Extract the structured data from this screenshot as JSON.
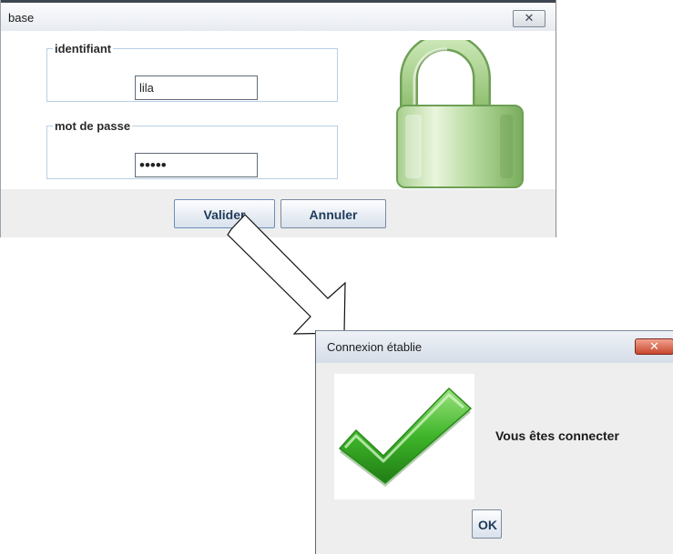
{
  "login_window": {
    "title": "base",
    "close_icon": "close-icon",
    "identifiant": {
      "legend": "identifiant",
      "value": "lila"
    },
    "password": {
      "legend": "mot de passe",
      "masked_value": "•••••"
    },
    "image": "open-padlock-icon",
    "buttons": {
      "valider": "Valider",
      "annuler": "Annuler"
    }
  },
  "arrow": {
    "icon": "down-right-arrow"
  },
  "confirm_dialog": {
    "title": "Connexion établie",
    "close_icon": "close-icon",
    "image": "green-checkmark-icon",
    "message": "Vous êtes connecter",
    "ok_button": "OK"
  },
  "colors": {
    "lock_green": "#9ccc7f",
    "check_green": "#3fb52a",
    "close_red": "#c8462d",
    "group_border": "#b8cfe5"
  }
}
